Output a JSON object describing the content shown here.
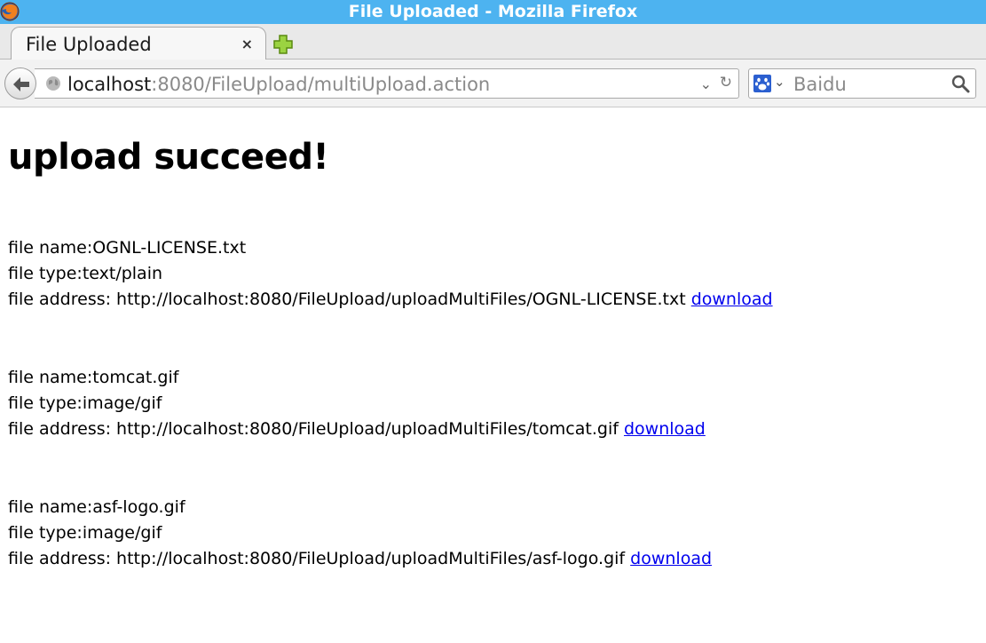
{
  "window": {
    "title": "File Uploaded - Mozilla Firefox"
  },
  "tab": {
    "label": "File Uploaded",
    "close": "×"
  },
  "navbar": {
    "url_host": "localhost",
    "url_rest": ":8080/FileUpload/multiUpload.action",
    "search_placeholder": "Baidu"
  },
  "page": {
    "heading": "upload succeed!",
    "files": [
      {
        "name_line": "file name:OGNL-LICENSE.txt",
        "type_line": "file type:text/plain",
        "address_line": "file address: http://localhost:8080/FileUpload/uploadMultiFiles/OGNL-LICENSE.txt",
        "link_label": "download"
      },
      {
        "name_line": "file name:tomcat.gif",
        "type_line": "file type:image/gif",
        "address_line": "file address: http://localhost:8080/FileUpload/uploadMultiFiles/tomcat.gif",
        "link_label": "download"
      },
      {
        "name_line": "file name:asf-logo.gif",
        "type_line": "file type:image/gif",
        "address_line": "file address: http://localhost:8080/FileUpload/uploadMultiFiles/asf-logo.gif",
        "link_label": "download"
      }
    ]
  },
  "colors": {
    "titlebar": "#4db3f0",
    "link": "#0000ee"
  },
  "icons": [
    "firefox-icon",
    "new-tab-icon",
    "back-arrow-icon",
    "globe-icon",
    "dropdown-icon",
    "reload-icon",
    "baidu-paw-icon",
    "search-icon"
  ]
}
